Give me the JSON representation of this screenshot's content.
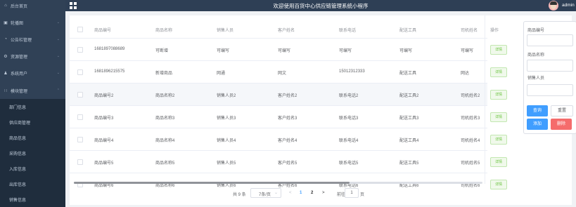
{
  "sidebar": {
    "home": {
      "label": "后台首页",
      "icon": "home-icon"
    },
    "items": [
      {
        "label": "轮播图",
        "icon": "image-icon"
      },
      {
        "label": "公告栏管理",
        "icon": "notice-icon"
      },
      {
        "label": "资源管理",
        "icon": "resource-icon"
      },
      {
        "label": "系统用户",
        "icon": "user-icon"
      },
      {
        "label": "模块管理",
        "icon": "module-icon"
      }
    ],
    "subitems": [
      "部门信息",
      "供应商管理",
      "商品信息",
      "采购信息",
      "入库信息",
      "出库信息",
      "销售信息"
    ]
  },
  "header": {
    "title": "欢迎使用百货中心供应链管理系统小程序",
    "user": "admin"
  },
  "table": {
    "columns": [
      "商品编号",
      "商品名称",
      "销售人员",
      "客户姓名",
      "联系电话",
      "配送工具",
      "司机姓名",
      "操作"
    ],
    "rows": [
      [
        "1681897088689",
        "可断增",
        "可编写",
        "可编写",
        "可编写",
        "可编写",
        "可编写"
      ],
      [
        "1681896215575",
        "新增商品",
        "网通",
        "网文",
        "15012312333",
        "配送工具",
        "网达"
      ],
      [
        "商品编号2",
        "商品名称2",
        "销售人员2",
        "客户姓名2",
        "联系电话2",
        "配送工具2",
        "司机姓名2"
      ],
      [
        "商品编号3",
        "商品名称3",
        "销售人员3",
        "客户姓名3",
        "联系电话3",
        "配送工具3",
        "司机姓名3"
      ],
      [
        "商品编号4",
        "商品名称4",
        "销售人员4",
        "客户姓名4",
        "联系电话4",
        "配送工具4",
        "司机姓名4"
      ],
      [
        "商品编号5",
        "商品名称5",
        "销售人员5",
        "客户姓名5",
        "联系电话5",
        "配送工具5",
        "司机姓名5"
      ],
      [
        "商品编号6",
        "商品名称6",
        "销售人员6",
        "客户姓名6",
        "联系电话6",
        "配送工具6",
        "司机姓名6"
      ]
    ],
    "detail_label": "详情"
  },
  "pagination": {
    "total": "共 9 条",
    "page_size": "7条/页",
    "prev": "<",
    "pages": [
      "1",
      "2"
    ],
    "next": ">",
    "goto": "前往",
    "goto_value": "1",
    "page_unit": "页"
  },
  "search": {
    "fields": [
      "商品编号",
      "商品名称",
      "销售人员"
    ],
    "buttons": {
      "query": "查询",
      "reset": "重置",
      "add": "添加",
      "delete": "删除"
    }
  },
  "colors": {
    "sidebar": "#304156",
    "primary": "#409eff",
    "success": "#67c23a",
    "danger": "#f56c6c"
  }
}
